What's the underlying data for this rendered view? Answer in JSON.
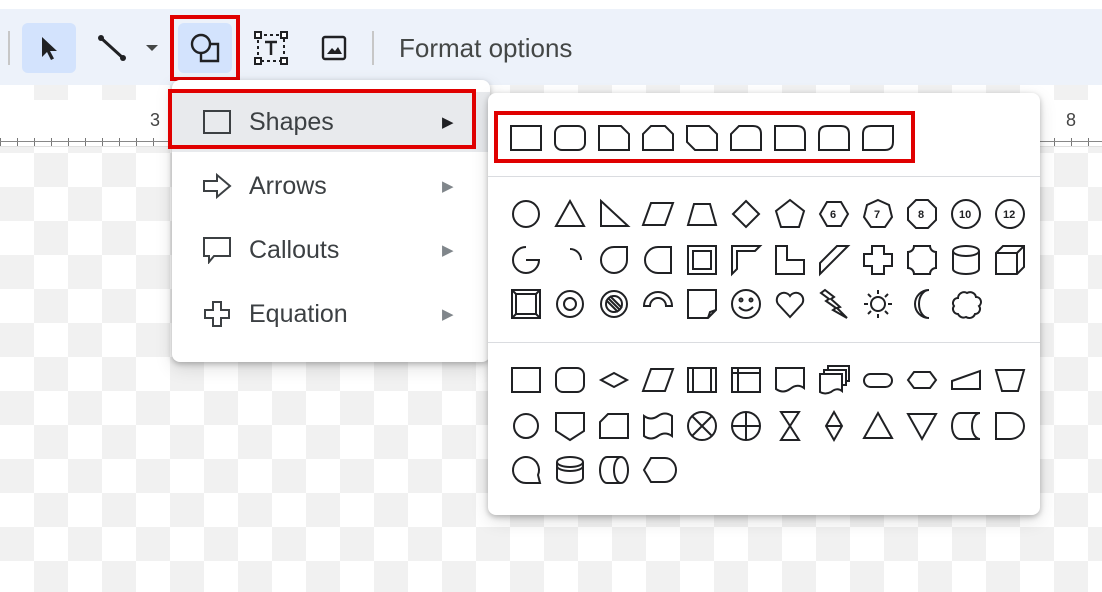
{
  "toolbar": {
    "format_options_label": "Format options",
    "tools": [
      {
        "name": "select-tool",
        "icon": "cursor-arrow-icon"
      },
      {
        "name": "line-tool",
        "icon": "line-icon"
      },
      {
        "name": "line-dropdown",
        "icon": "caret-down-icon"
      },
      {
        "name": "shape-tool",
        "icon": "shape-icon"
      },
      {
        "name": "text-box-tool",
        "icon": "text-box-icon"
      },
      {
        "name": "image-tool",
        "icon": "image-icon"
      }
    ]
  },
  "ruler": {
    "left_number": "3",
    "right_number": "8"
  },
  "menu": {
    "items": [
      {
        "label": "Shapes",
        "icon": "rectangle-icon",
        "arrow": "▶",
        "active": true
      },
      {
        "label": "Arrows",
        "icon": "arrow-right-outline-icon",
        "arrow": "▶"
      },
      {
        "label": "Callouts",
        "icon": "speech-callout-icon",
        "arrow": "▶"
      },
      {
        "label": "Equation",
        "icon": "plus-outline-icon",
        "arrow": "▶"
      }
    ]
  },
  "submenu": {
    "rectangles": [
      "rectangle",
      "rounded-rectangle",
      "snip-single-corner-rectangle",
      "snip-same-side-corner-rectangle",
      "snip-diagonal-corner-rectangle",
      "snip-round-single-corner-rectangle",
      "round-single-corner-rectangle",
      "round-same-side-corner-rectangle",
      "round-diagonal-corner-rectangle"
    ],
    "basic_shapes_row1": [
      "oval",
      "triangle",
      "right-triangle",
      "parallelogram",
      "trapezoid",
      "diamond",
      "pentagon",
      "hexagon",
      "heptagon",
      "octagon",
      "decagon",
      "dodecagon"
    ],
    "basic_shapes_row1_labels": {
      "hexagon": "6",
      "heptagon": "7",
      "octagon": "8",
      "decagon": "10",
      "dodecagon": "12"
    },
    "basic_shapes_row2": [
      "pie",
      "arc",
      "teardrop",
      "chord",
      "frame",
      "half-frame",
      "l-shape",
      "diagonal-stripe",
      "cross",
      "plaque",
      "can",
      "cube"
    ],
    "basic_shapes_row3": [
      "bevel",
      "donut",
      "no-symbol",
      "block-arc",
      "folded-corner",
      "smiley-face",
      "heart",
      "lightning-bolt",
      "sun",
      "moon",
      "cloud"
    ],
    "flowchart_row1": [
      "flowchart-process",
      "flowchart-alternate-process",
      "flowchart-decision",
      "flowchart-data",
      "flowchart-predefined-process",
      "flowchart-internal-storage",
      "flowchart-document",
      "flowchart-multidocument",
      "flowchart-terminator",
      "flowchart-preparation",
      "flowchart-manual-input",
      "flowchart-manual-operation"
    ],
    "flowchart_row2": [
      "flowchart-connector",
      "flowchart-offpage-connector",
      "flowchart-card",
      "flowchart-punched-tape",
      "flowchart-summing-junction",
      "flowchart-or",
      "flowchart-collate",
      "flowchart-sort",
      "flowchart-extract",
      "flowchart-merge",
      "flowchart-stored-data",
      "flowchart-delay"
    ],
    "flowchart_row3": [
      "flowchart-sequential-access-storage",
      "flowchart-magnetic-disk",
      "flowchart-direct-access-storage",
      "flowchart-display"
    ]
  },
  "highlight_color": "#e00000"
}
